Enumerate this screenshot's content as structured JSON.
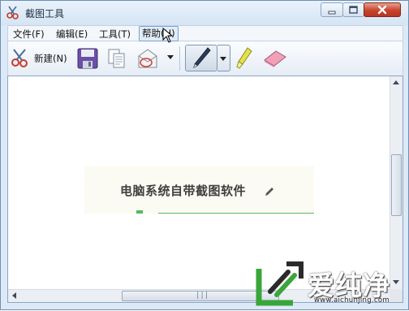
{
  "window": {
    "title": "截图工具",
    "controls": [
      "minimize-icon",
      "maximize-icon",
      "close-icon"
    ]
  },
  "menu": {
    "items": [
      {
        "label": "文件(F)"
      },
      {
        "label": "编辑(E)"
      },
      {
        "label": "工具(T)"
      },
      {
        "label": "帮助(H)",
        "active": true
      }
    ]
  },
  "toolbar": {
    "new_label": "新建(N)",
    "icons": [
      "new-snip-icon",
      "save-icon",
      "copy-icon",
      "send-icon",
      "pen-icon",
      "highlighter-icon",
      "eraser-icon"
    ]
  },
  "canvas": {
    "banner_text": "电脑系统自带截图软件"
  },
  "watermark": {
    "brand": "爱纯净",
    "url": "www.aichunjing.com",
    "accent_color": "#3aa53a"
  },
  "colors": {
    "title_bar": "#dbe7f5",
    "close_button": "#c8432c",
    "highlighter": "#e6e14a",
    "eraser": "#f2a0b8"
  }
}
